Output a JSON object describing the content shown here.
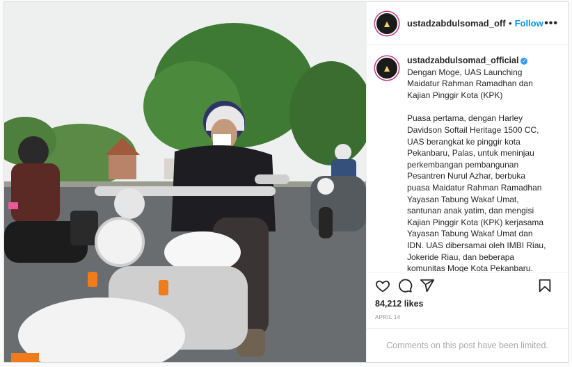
{
  "post": {
    "username": "ustadzabdulsomad_offic",
    "separator": "•",
    "follow_label": "Follow",
    "more_label": "•••",
    "avatar_glyph": "▲",
    "photo_label": "Moge riders on Harley motorcycles",
    "caption": {
      "username": "ustadzabdulsomad_official",
      "verified_glyph": "✓",
      "headline": "Dengan Moge, UAS Launching\nMaidatur Rahman Ramadhan dan\nKajian Pinggir Kota (KPK)",
      "body": "Puasa pertama, dengan Harley\nDavidson Softail Heritage 1500 CC,\nUAS berangkat ke pinggir kota\nPekanbaru, Palas, untuk meninjau\nperkembangan pembangunan\nPesantren Nurul Azhar, berbuka\npuasa Maidatur Rahman Ramadhan\nYayasan Tabung Wakaf Umat,\nsantunan anak yatim, dan mengisi\nKajian Pinggir Kota (KPK) kerjasama\nYayasan Tabung Wakaf Umat dan\nIDN. UAS dibersamai oleh IMBI Riau,\nJokeride Riau, dan beberapa\nkomunitas Moge Kota Pekanbaru."
    },
    "likes": "84,212 likes",
    "date": "APRIL 14",
    "comments_limited": "Comments on this post have been limited."
  },
  "colors": {
    "accent": "#0095f6",
    "verified": "#3897f0",
    "muted": "#8e8e8e"
  },
  "icons": [
    "heart-icon",
    "comment-icon",
    "share-icon",
    "bookmark-icon",
    "more-icon",
    "verified-icon"
  ]
}
